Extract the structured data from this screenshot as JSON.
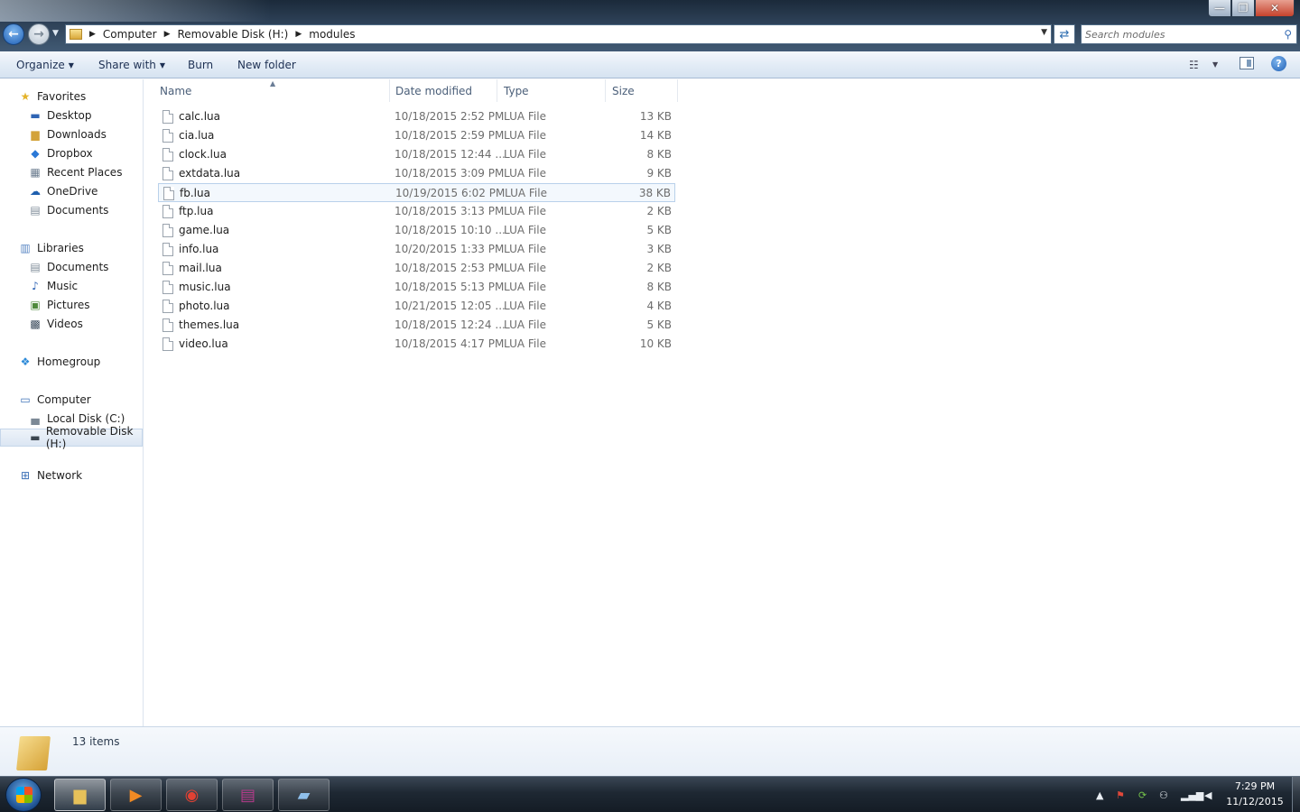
{
  "window": {
    "controls": {
      "minimize": "—",
      "maximize": "❐",
      "close": "✕"
    }
  },
  "address": {
    "breadcrumbs": [
      "Computer",
      "Removable Disk (H:)",
      "modules"
    ]
  },
  "search": {
    "placeholder": "Search modules"
  },
  "toolbar": {
    "organize": "Organize",
    "share_with": "Share with",
    "burn": "Burn",
    "new_folder": "New folder"
  },
  "nav": {
    "favorites": {
      "label": "Favorites",
      "items": [
        "Desktop",
        "Downloads",
        "Dropbox",
        "Recent Places",
        "OneDrive",
        "Documents"
      ]
    },
    "libraries": {
      "label": "Libraries",
      "items": [
        "Documents",
        "Music",
        "Pictures",
        "Videos"
      ]
    },
    "homegroup": {
      "label": "Homegroup"
    },
    "computer": {
      "label": "Computer",
      "items": [
        "Local Disk (C:)",
        "Removable Disk (H:)"
      ],
      "selected": "Removable Disk (H:)"
    },
    "network": {
      "label": "Network"
    }
  },
  "columns": {
    "name": "Name",
    "date": "Date modified",
    "type": "Type",
    "size": "Size"
  },
  "files": [
    {
      "name": "calc.lua",
      "date": "10/18/2015 2:52 PM",
      "type": "LUA File",
      "size": "13 KB"
    },
    {
      "name": "cia.lua",
      "date": "10/18/2015 2:59 PM",
      "type": "LUA File",
      "size": "14 KB"
    },
    {
      "name": "clock.lua",
      "date": "10/18/2015 12:44 ...",
      "type": "LUA File",
      "size": "8 KB"
    },
    {
      "name": "extdata.lua",
      "date": "10/18/2015 3:09 PM",
      "type": "LUA File",
      "size": "9 KB"
    },
    {
      "name": "fb.lua",
      "date": "10/19/2015 6:02 PM",
      "type": "LUA File",
      "size": "38 KB"
    },
    {
      "name": "ftp.lua",
      "date": "10/18/2015 3:13 PM",
      "type": "LUA File",
      "size": "2 KB"
    },
    {
      "name": "game.lua",
      "date": "10/18/2015 10:10 ...",
      "type": "LUA File",
      "size": "5 KB"
    },
    {
      "name": "info.lua",
      "date": "10/20/2015 1:33 PM",
      "type": "LUA File",
      "size": "3 KB"
    },
    {
      "name": "mail.lua",
      "date": "10/18/2015 2:53 PM",
      "type": "LUA File",
      "size": "2 KB"
    },
    {
      "name": "music.lua",
      "date": "10/18/2015 5:13 PM",
      "type": "LUA File",
      "size": "8 KB"
    },
    {
      "name": "photo.lua",
      "date": "10/21/2015 12:05 ...",
      "type": "LUA File",
      "size": "4 KB"
    },
    {
      "name": "themes.lua",
      "date": "10/18/2015 12:24 ...",
      "type": "LUA File",
      "size": "5 KB"
    },
    {
      "name": "video.lua",
      "date": "10/18/2015 4:17 PM",
      "type": "LUA File",
      "size": "10 KB"
    }
  ],
  "hovered_file": "fb.lua",
  "status": {
    "items_count": "13 items"
  },
  "taskbar": {
    "apps": [
      "windows-explorer",
      "media-player",
      "chrome",
      "winrar",
      "notepad"
    ],
    "active_app": "windows-explorer",
    "clock_time": "7:29 PM",
    "clock_date": "11/12/2015"
  }
}
